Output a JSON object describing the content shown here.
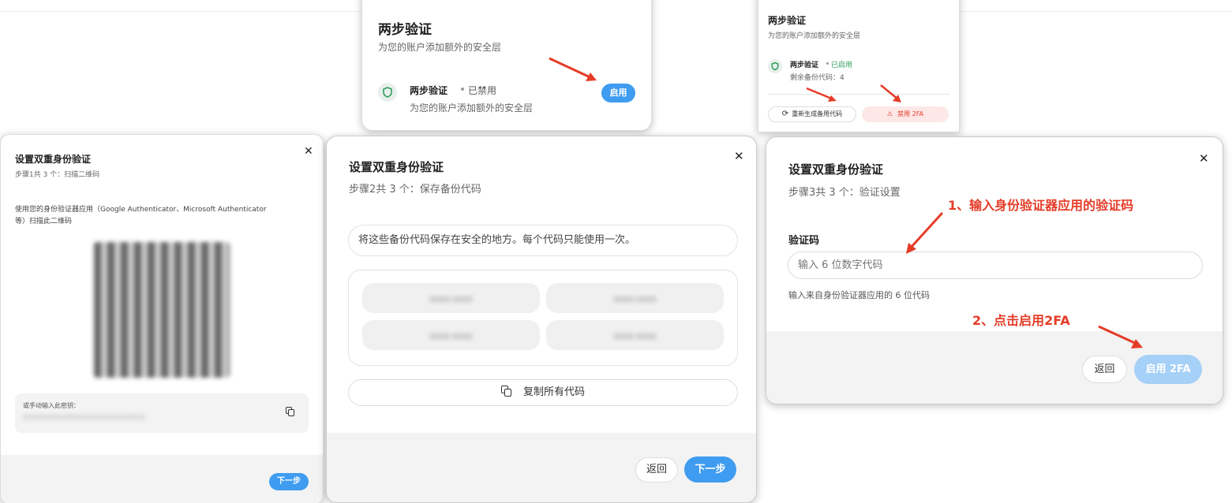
{
  "card_disabled": {
    "title": "两步验证",
    "subtitle": "为您的账户添加额外的安全层",
    "row_name": "两步验证",
    "row_status": "已禁用",
    "row_desc": "为您的账户添加额外的安全层",
    "enable_button": "启用"
  },
  "card_enabled": {
    "title": "两步验证",
    "subtitle": "为您的账户添加额外的安全层",
    "row_name": "两步验证",
    "row_status": "已启用",
    "backup_remaining": "剩余备份代码：4",
    "regenerate_button": "重新生成备用代码",
    "disable_button": "禁用 2FA"
  },
  "step1": {
    "title": "设置双重身份验证",
    "step": "步骤1共 3 个：扫描二维码",
    "instruction": "使用您的身份验证器应用（Google Authenticator、Microsoft Authenticator 等）扫描此二维码",
    "manual_label": "或手动输入此密钥：",
    "manual_key": "XXXXXXXXXXXXXXXXXXXXXXXXXX",
    "next_button": "下一步"
  },
  "step2": {
    "title": "设置双重身份验证",
    "step": "步骤2共 3 个：保存备份代码",
    "notice": "将这些备份代码保存在安全的地方。每个代码只能使用一次。",
    "codes": [
      "0000-0000",
      "0000-0000",
      "0000-0000",
      "0000-0000"
    ],
    "copy_button": "复制所有代码",
    "back_button": "返回",
    "next_button": "下一步"
  },
  "step3": {
    "title": "设置双重身份验证",
    "step": "步骤3共 3 个：验证设置",
    "code_label": "验证码",
    "code_placeholder": "输入 6 位数字代码",
    "hint": "输入来自身份验证器应用的 6 位代码",
    "back_button": "返回",
    "enable_button": "启用 2FA"
  },
  "annotations": {
    "step1": "1、输入身份验证器应用的验证码",
    "step2": "2、点击启用2FA"
  },
  "colors": {
    "accent": "#3f9cf0",
    "success": "#2e9e5b",
    "danger": "#e53c28",
    "danger_bg": "#fde7e7"
  }
}
